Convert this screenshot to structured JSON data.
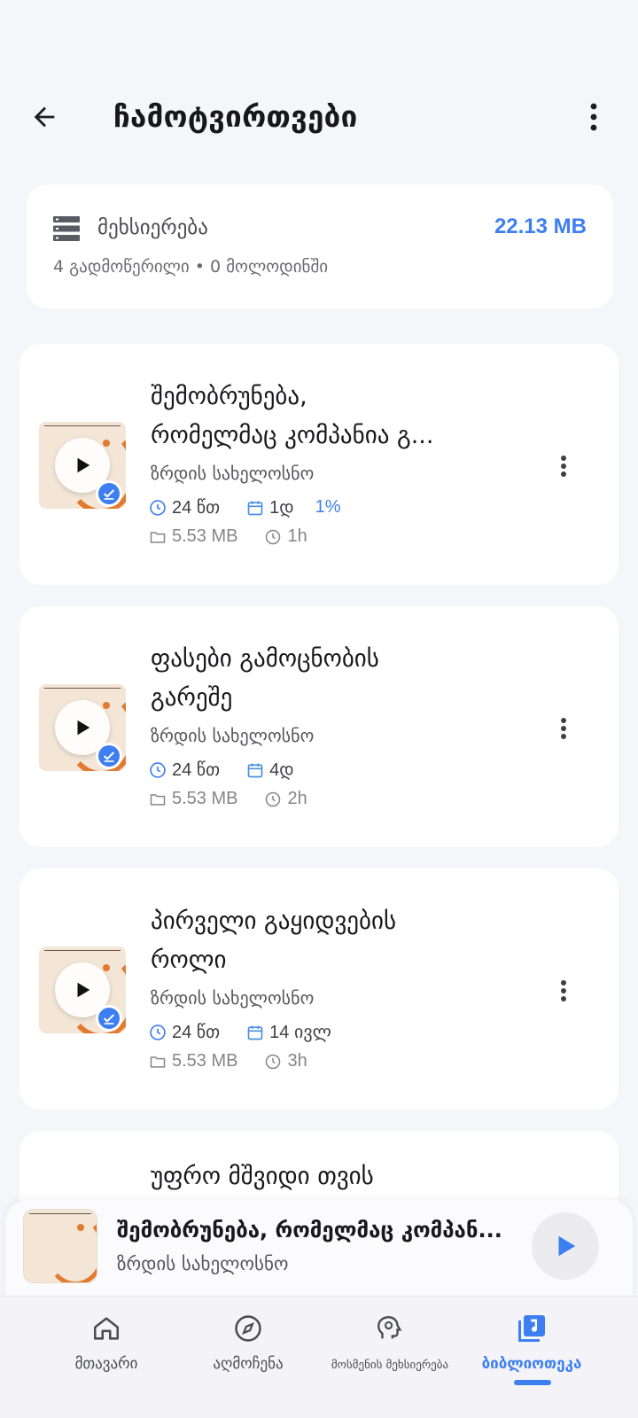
{
  "header": {
    "title": "ჩამოტვირთვები",
    "back_icon": "arrow-left-icon",
    "menu_icon": "more-vertical-icon"
  },
  "storage": {
    "label": "მეხსიერება",
    "size": "22.13 MB",
    "summary": "4 გადმოწერილი • 0 მოლოდინში"
  },
  "episodes": [
    {
      "title_line1": "შემობრუნება,",
      "title_line2": "რომელმაც კომპანია გ...",
      "show": "ზრდის სახელოსნო",
      "duration": "24 წთ",
      "date": "1დ",
      "progress": "1%",
      "file_size": "5.53 MB",
      "downloaded_ago": "1h"
    },
    {
      "title_line1": "ფასები გამოცნობის",
      "title_line2": "გარეშე",
      "show": "ზრდის სახელოსნო",
      "duration": "24 წთ",
      "date": "4დ",
      "file_size": "5.53 MB",
      "downloaded_ago": "2h"
    },
    {
      "title_line1": "პირველი გაყიდვების",
      "title_line2": "როლი",
      "show": "ზრდის სახელოსნო",
      "duration": "24 წთ",
      "date": "14 ივლ",
      "file_size": "5.53 MB",
      "downloaded_ago": "3h"
    },
    {
      "title_line1": "უფრო მშვიდი თვის"
    }
  ],
  "mini_player": {
    "title": "შემობრუნება, რომელმაც კომპან...",
    "show": "ზრდის სახელოსნო"
  },
  "bottom_nav": [
    {
      "label": "მთავარი",
      "icon": "home-icon"
    },
    {
      "label": "აღმოჩენა",
      "icon": "compass-icon"
    },
    {
      "label": "მოსმენის მეხსიერება",
      "icon": "brain-head-icon"
    },
    {
      "label": "ბიბლიოთეკა",
      "icon": "music-library-icon",
      "active": true
    }
  ],
  "colors": {
    "accent": "#3d7ff0",
    "background": "#f5f6fa",
    "card": "#ffffff",
    "thumb_orange": "#e27a30"
  }
}
